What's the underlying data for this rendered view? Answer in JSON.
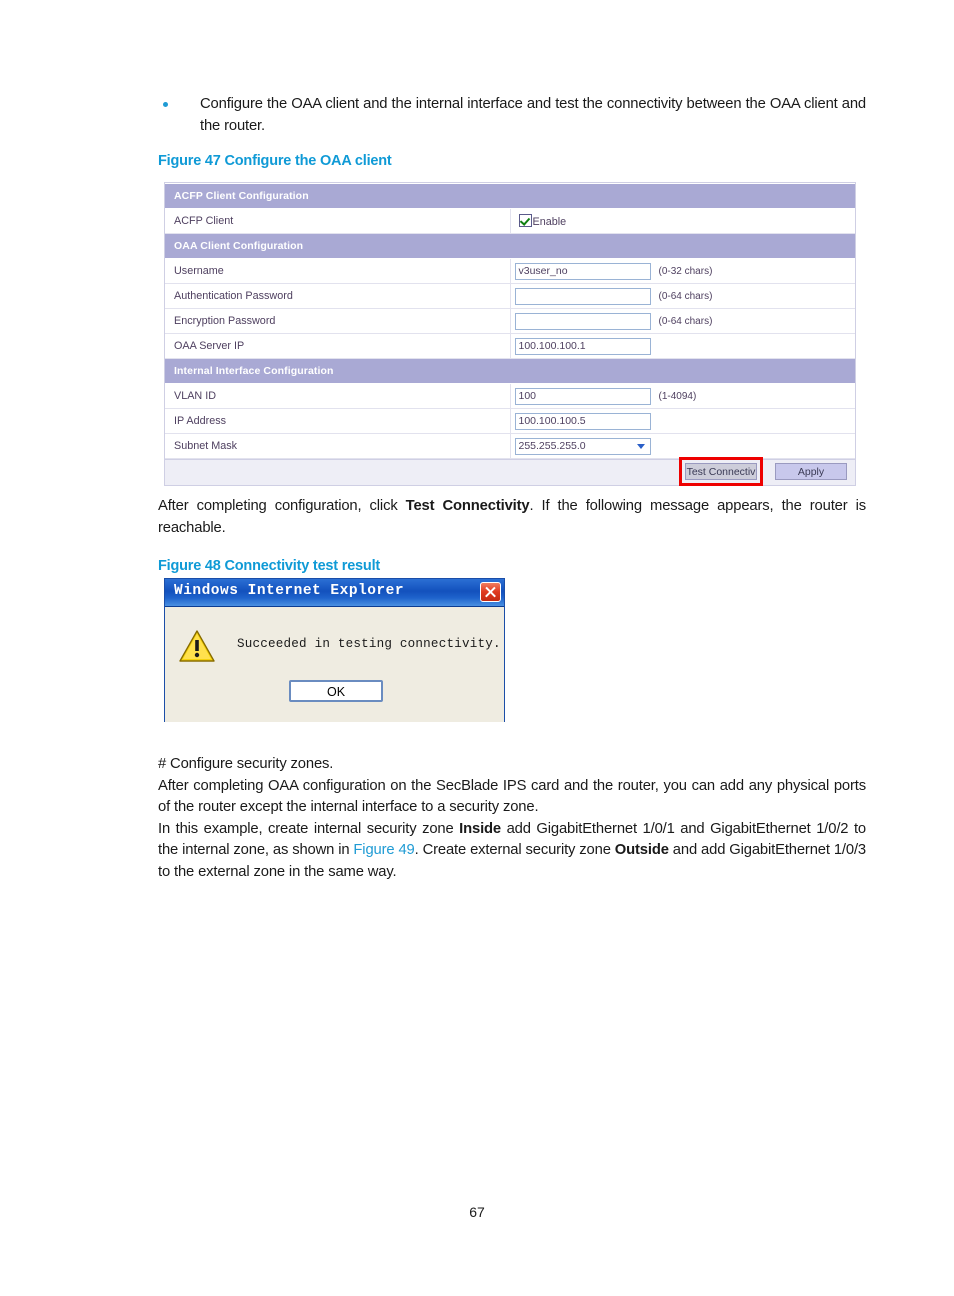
{
  "document": {
    "page_number": "67"
  },
  "bullet": {
    "text": "Configure the OAA client and the internal interface and test the connectivity between the OAA client and the router."
  },
  "figure47": {
    "caption": "Figure 47 Configure the OAA client",
    "sections": [
      {
        "title": "ACFP Client Configuration"
      },
      {
        "title": "OAA Client Configuration"
      },
      {
        "title": "Internal Interface Configuration"
      }
    ],
    "acfp_client": {
      "label": "ACFP Client",
      "checkbox_label": "Enable",
      "checked": true
    },
    "oaa_client": {
      "username": {
        "label": "Username",
        "value": "v3user_no",
        "hint": "(0-32 chars)"
      },
      "auth_password": {
        "label": "Authentication Password",
        "value": "",
        "hint": "(0-64 chars)"
      },
      "enc_password": {
        "label": "Encryption Password",
        "value": "",
        "hint": "(0-64 chars)"
      },
      "oaa_server_ip": {
        "label": "OAA Server IP",
        "value": "100.100.100.1",
        "hint": ""
      }
    },
    "internal_interface": {
      "vlan_id": {
        "label": "VLAN ID",
        "value": "100",
        "hint": "(1-4094)"
      },
      "ip_address": {
        "label": "IP Address",
        "value": "100.100.100.5",
        "hint": ""
      },
      "subnet_mask": {
        "label": "Subnet Mask",
        "value": "255.255.255.0",
        "hint": ""
      }
    },
    "buttons": {
      "test_connectivity": "Test Connectiv",
      "apply": "Apply"
    },
    "colors": {
      "section_header": "#a9a9d4",
      "highlight_box": "#ee0000",
      "caption": "#0f9ad6"
    }
  },
  "paragraph1": {
    "part1": "After completing configuration, click ",
    "bold1": "Test Connectivity",
    "part2": ". If the following message appears, the router is reachable."
  },
  "figure48": {
    "caption": "Figure 48 Connectivity test result",
    "dialog": {
      "title": "Windows Internet Explorer",
      "message": "Succeeded in testing connectivity.",
      "ok_label": "OK",
      "icon": "warning-triangle-icon",
      "close_icon": "close-icon"
    }
  },
  "paragraph2": {
    "text": "# Configure security zones."
  },
  "paragraph3": {
    "text": "After completing OAA configuration on the SecBlade IPS card and the router, you can add any physical ports of the router except the internal interface to a security zone."
  },
  "paragraph4": {
    "part1": "In this example, create internal security zone ",
    "bold1": "Inside",
    "part2": " add GigabitEthernet 1/0/1 and GigabitEthernet 1/0/2 to the internal zone, as shown in ",
    "link1": "Figure 49",
    "part3": ". Create external security zone ",
    "bold2": "Outside",
    "part4": " and add GigabitEthernet 1/0/3 to the external zone in the same way."
  }
}
